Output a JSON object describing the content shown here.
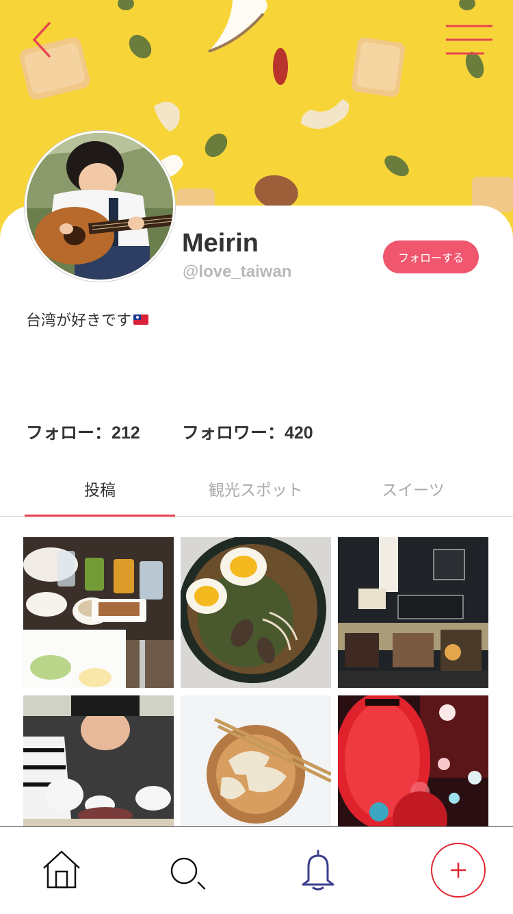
{
  "profile": {
    "name": "Meirin",
    "handle": "@love_taiwan",
    "follow_label": "フォローする",
    "bio": "台湾が好きです"
  },
  "stats": {
    "following_label": "フォロー：212",
    "followers_label": "フォロワー：420"
  },
  "tabs": [
    {
      "label": "投稿",
      "active": true
    },
    {
      "label": "観光スポット",
      "active": false
    },
    {
      "label": "スイーツ",
      "active": false
    }
  ],
  "icons": {
    "back": "chevron-left-icon",
    "menu": "hamburger-menu-icon",
    "nav": [
      "home-icon",
      "search-icon",
      "bell-icon",
      "plus-icon"
    ]
  },
  "colors": {
    "accent": "#f0566e",
    "tab_indicator": "#e8434f",
    "banner": "#f7d539"
  }
}
